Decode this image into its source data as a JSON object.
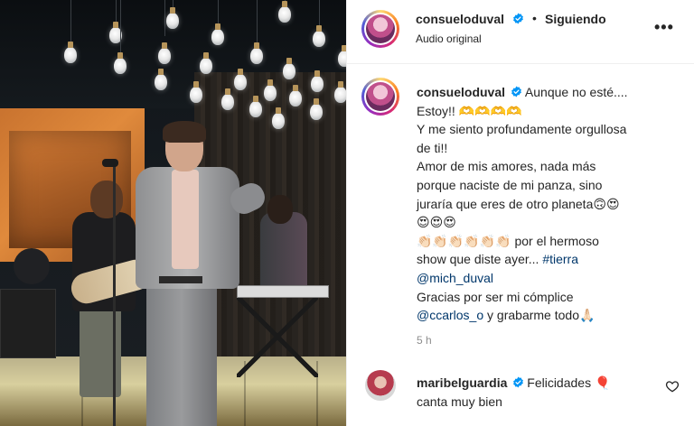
{
  "post": {
    "author": {
      "username": "consueloduval",
      "verified": true,
      "separator": "•",
      "follow_status": "Siguiendo",
      "audio": "Audio original"
    },
    "more_label": "•••",
    "caption": {
      "username": "consueloduval",
      "lines": [
        "Aunque no esté....",
        "Estoy!! 🫶🫶🫶🫶",
        "Y me siento profundamente orgullosa",
        "de ti!!",
        "Amor de mis amores, nada más",
        "porque naciste de mi panza, sino",
        "juraría que eres de otro planeta🙃😍",
        "😍😍😍",
        "👏🏻👏🏻👏🏻👏🏻👏🏻👏🏻 por el hermoso",
        "show que diste ayer... "
      ],
      "hashtag": "#tierra",
      "mention_1": "@mich_duval",
      "thanks": "Gracias por ser mi cómplice",
      "mention_2": "@ccarlos_o",
      "end_text": " y grabarme todo🙏🏻"
    },
    "timestamp": "5 h"
  },
  "comments": [
    {
      "username": "maribelguardia",
      "verified": true,
      "text_inline": "Felicidades 🎈",
      "text_line2": "canta muy bien"
    }
  ],
  "colors": {
    "verified_blue": "#0095f6",
    "link_blue": "#00376b",
    "muted": "#8e8e8e",
    "text": "#262626"
  }
}
